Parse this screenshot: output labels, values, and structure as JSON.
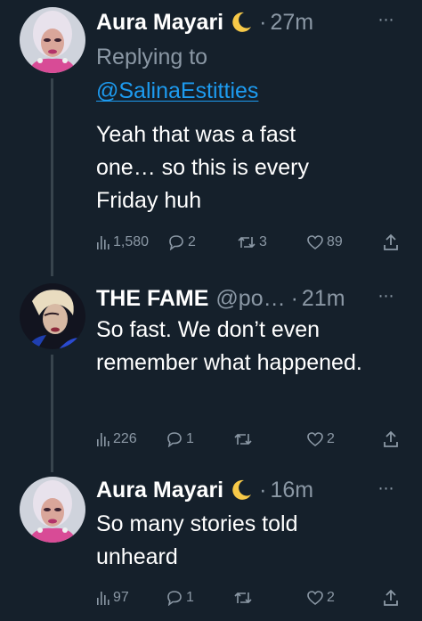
{
  "tweets": [
    {
      "author": "Aura Mayari",
      "badge_icon": "crescent-moon-emoji",
      "handle": "",
      "separator": "·",
      "time": "27m",
      "replying_label": "Replying to",
      "replying_handle": "@SalinaEstitties",
      "text": "Yeah that was a fast one… so this is every Friday huh",
      "views": "1,580",
      "replies": "2",
      "retweets": "3",
      "likes": "89"
    },
    {
      "author": "THE FAME",
      "handle": "@po…",
      "separator": "·",
      "time": "21m",
      "text": "So fast. We don’t even remember what happened.",
      "views": "226",
      "replies": "1",
      "retweets": "",
      "likes": "2"
    },
    {
      "author": "Aura Mayari",
      "badge_icon": "crescent-moon-emoji",
      "handle": "",
      "separator": "·",
      "time": "16m",
      "text": "So many stories told unheard",
      "views": "97",
      "replies": "1",
      "retweets": "",
      "likes": "2"
    }
  ],
  "more_icon": "⋯",
  "colors": {
    "background": "#15202b",
    "text": "#ffffff",
    "muted": "#8b98a5",
    "link": "#1d9bf0",
    "thread_line": "#38444d"
  }
}
